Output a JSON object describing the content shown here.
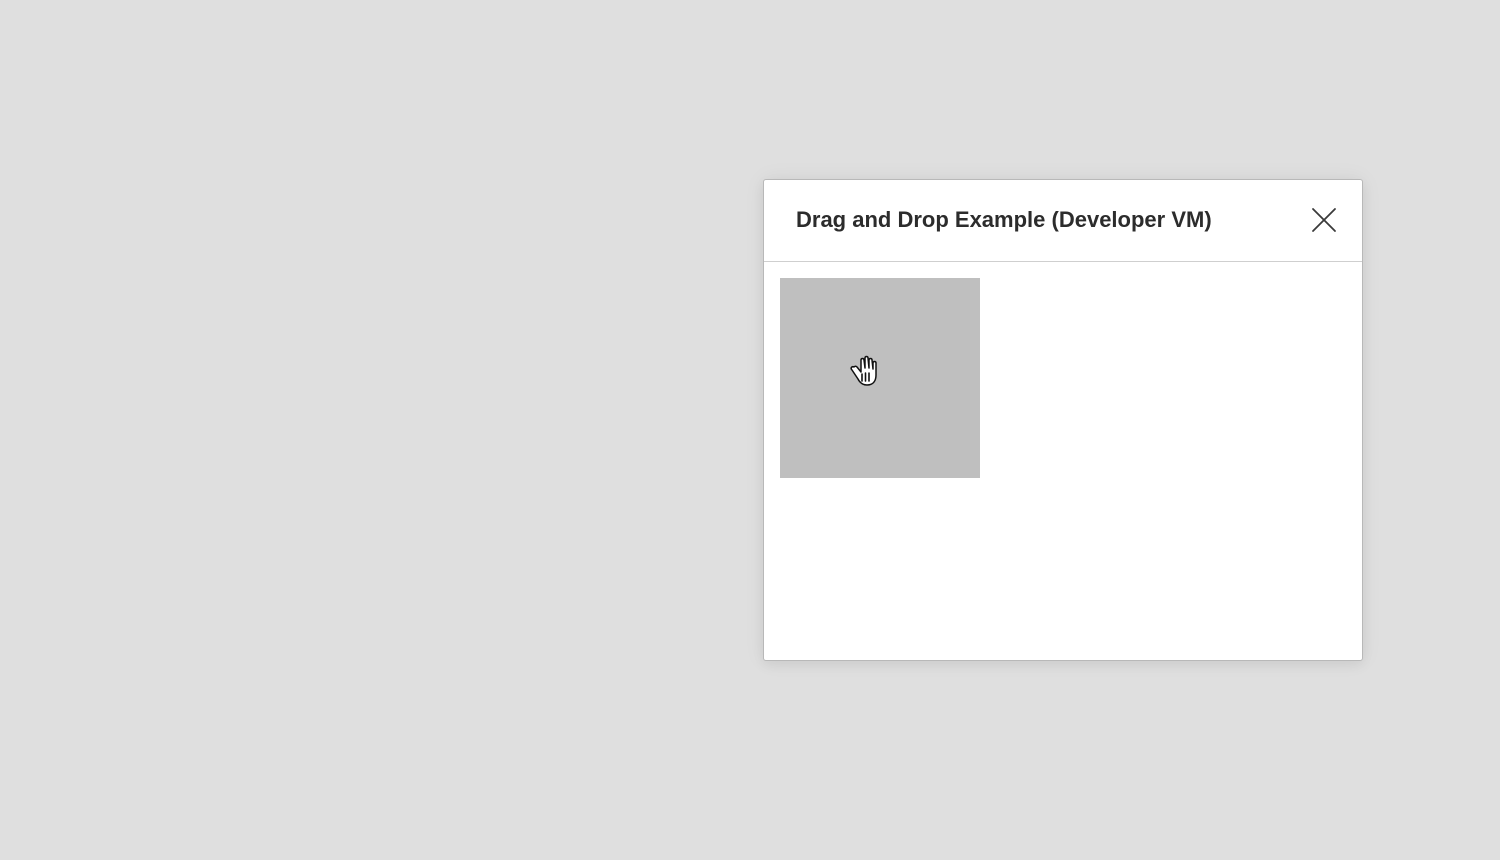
{
  "dialog": {
    "title": "Drag and Drop Example (Developer VM)",
    "close_icon": "close-icon"
  },
  "drag_box": {
    "color": "#bfbfbf"
  },
  "cursor": {
    "icon": "grab-hand-cursor-icon"
  },
  "colors": {
    "background": "#dfdfdf",
    "dialog_background": "#ffffff",
    "title_text": "#2c2c2c"
  }
}
